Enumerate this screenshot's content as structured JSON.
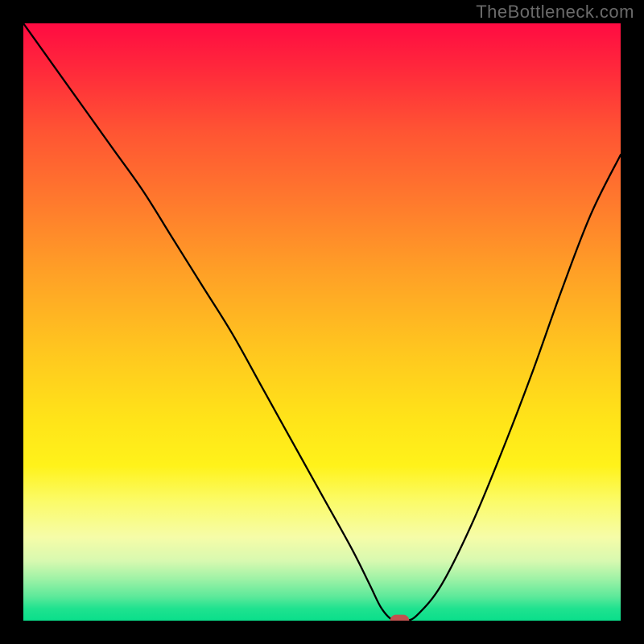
{
  "watermark": "TheBottleneck.com",
  "colors": {
    "background": "#000000",
    "curve": "#000000",
    "marker": "#c1524f"
  },
  "chart_data": {
    "type": "line",
    "title": "",
    "xlabel": "",
    "ylabel": "",
    "xlim": [
      0,
      100
    ],
    "ylim": [
      0,
      100
    ],
    "grid": false,
    "legend": false,
    "description": "Bottleneck mismatch curve: y = percent bottleneck (100 = worst, 0 = balanced) as a function of relative component strength x. Background gradient encodes severity (red high / green low).",
    "series": [
      {
        "name": "bottleneck-percent",
        "x": [
          0,
          5,
          10,
          15,
          20,
          25,
          30,
          35,
          40,
          45,
          50,
          55,
          58,
          60,
          62,
          64,
          66,
          70,
          75,
          80,
          85,
          90,
          95,
          100
        ],
        "y": [
          100,
          93,
          86,
          79,
          72,
          64,
          56,
          48,
          39,
          30,
          21,
          12,
          6,
          2,
          0,
          0,
          1,
          6,
          16,
          28,
          41,
          55,
          68,
          78
        ]
      }
    ],
    "marker": {
      "name": "balanced-point",
      "x": 63,
      "y": 0,
      "width_x": 3.2,
      "height_y": 2.0
    },
    "gradient_stops": [
      {
        "pos": 0,
        "color": "#ff0b42"
      },
      {
        "pos": 18,
        "color": "#ff5433"
      },
      {
        "pos": 42,
        "color": "#ffa126"
      },
      {
        "pos": 66,
        "color": "#ffe319"
      },
      {
        "pos": 86,
        "color": "#f6fca8"
      },
      {
        "pos": 100,
        "color": "#0adf8b"
      }
    ]
  }
}
